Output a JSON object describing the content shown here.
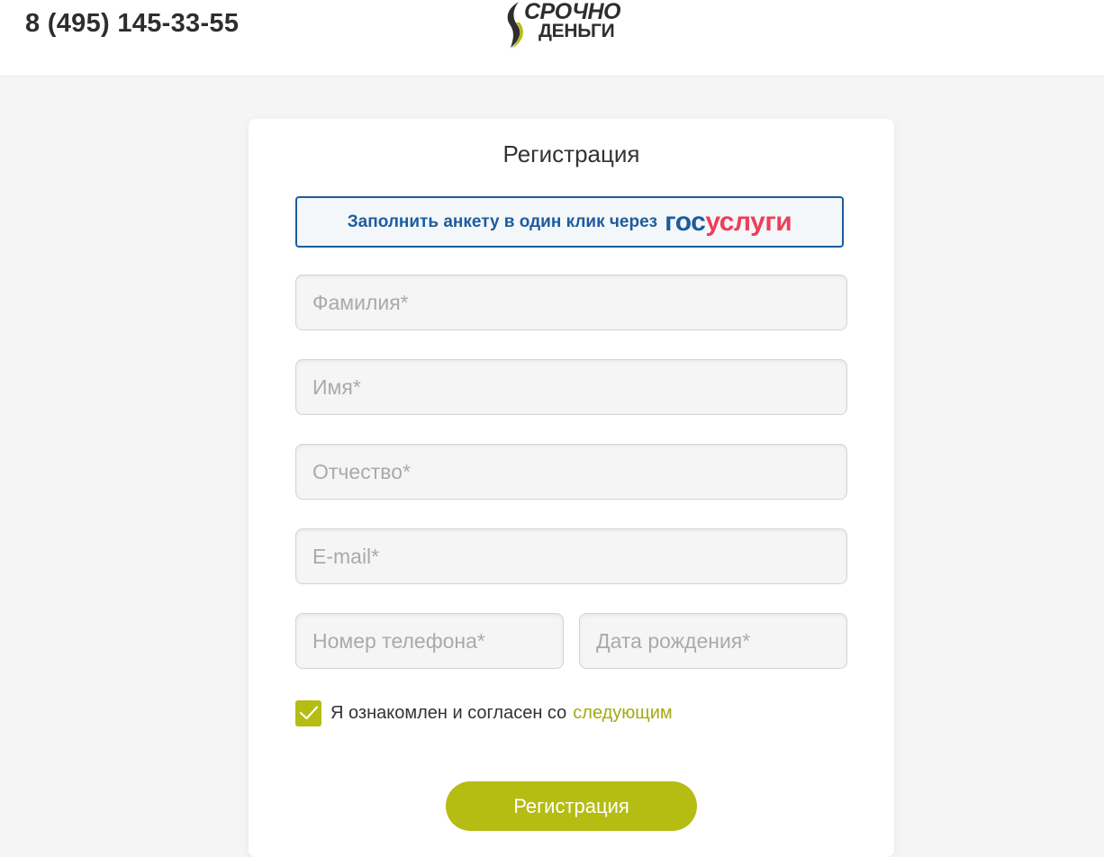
{
  "header": {
    "phone": "8 (495) 145-33-55",
    "logo": {
      "line1": "СРОЧНО",
      "line2": "ДЕНЬГИ"
    }
  },
  "form": {
    "title": "Регистрация",
    "gosuslugi": {
      "text": "Заполнить анкету в один клик через",
      "logo_gos": "гос",
      "logo_uslugi": "услуги"
    },
    "fields": {
      "last_name_placeholder": "Фамилия*",
      "first_name_placeholder": "Имя*",
      "patronymic_placeholder": "Отчество*",
      "email_placeholder": "E-mail*",
      "phone_placeholder": "Номер телефона*",
      "birthdate_placeholder": "Дата рождения*"
    },
    "agreement": {
      "checked": true,
      "text": "Я ознакомлен и согласен со",
      "link": "следующим"
    },
    "submit_label": "Регистрация"
  },
  "colors": {
    "accent": "#b5bc12",
    "gos_blue": "#1d5c9e",
    "gos_red": "#ee3f58",
    "background": "#f5f5f5"
  }
}
